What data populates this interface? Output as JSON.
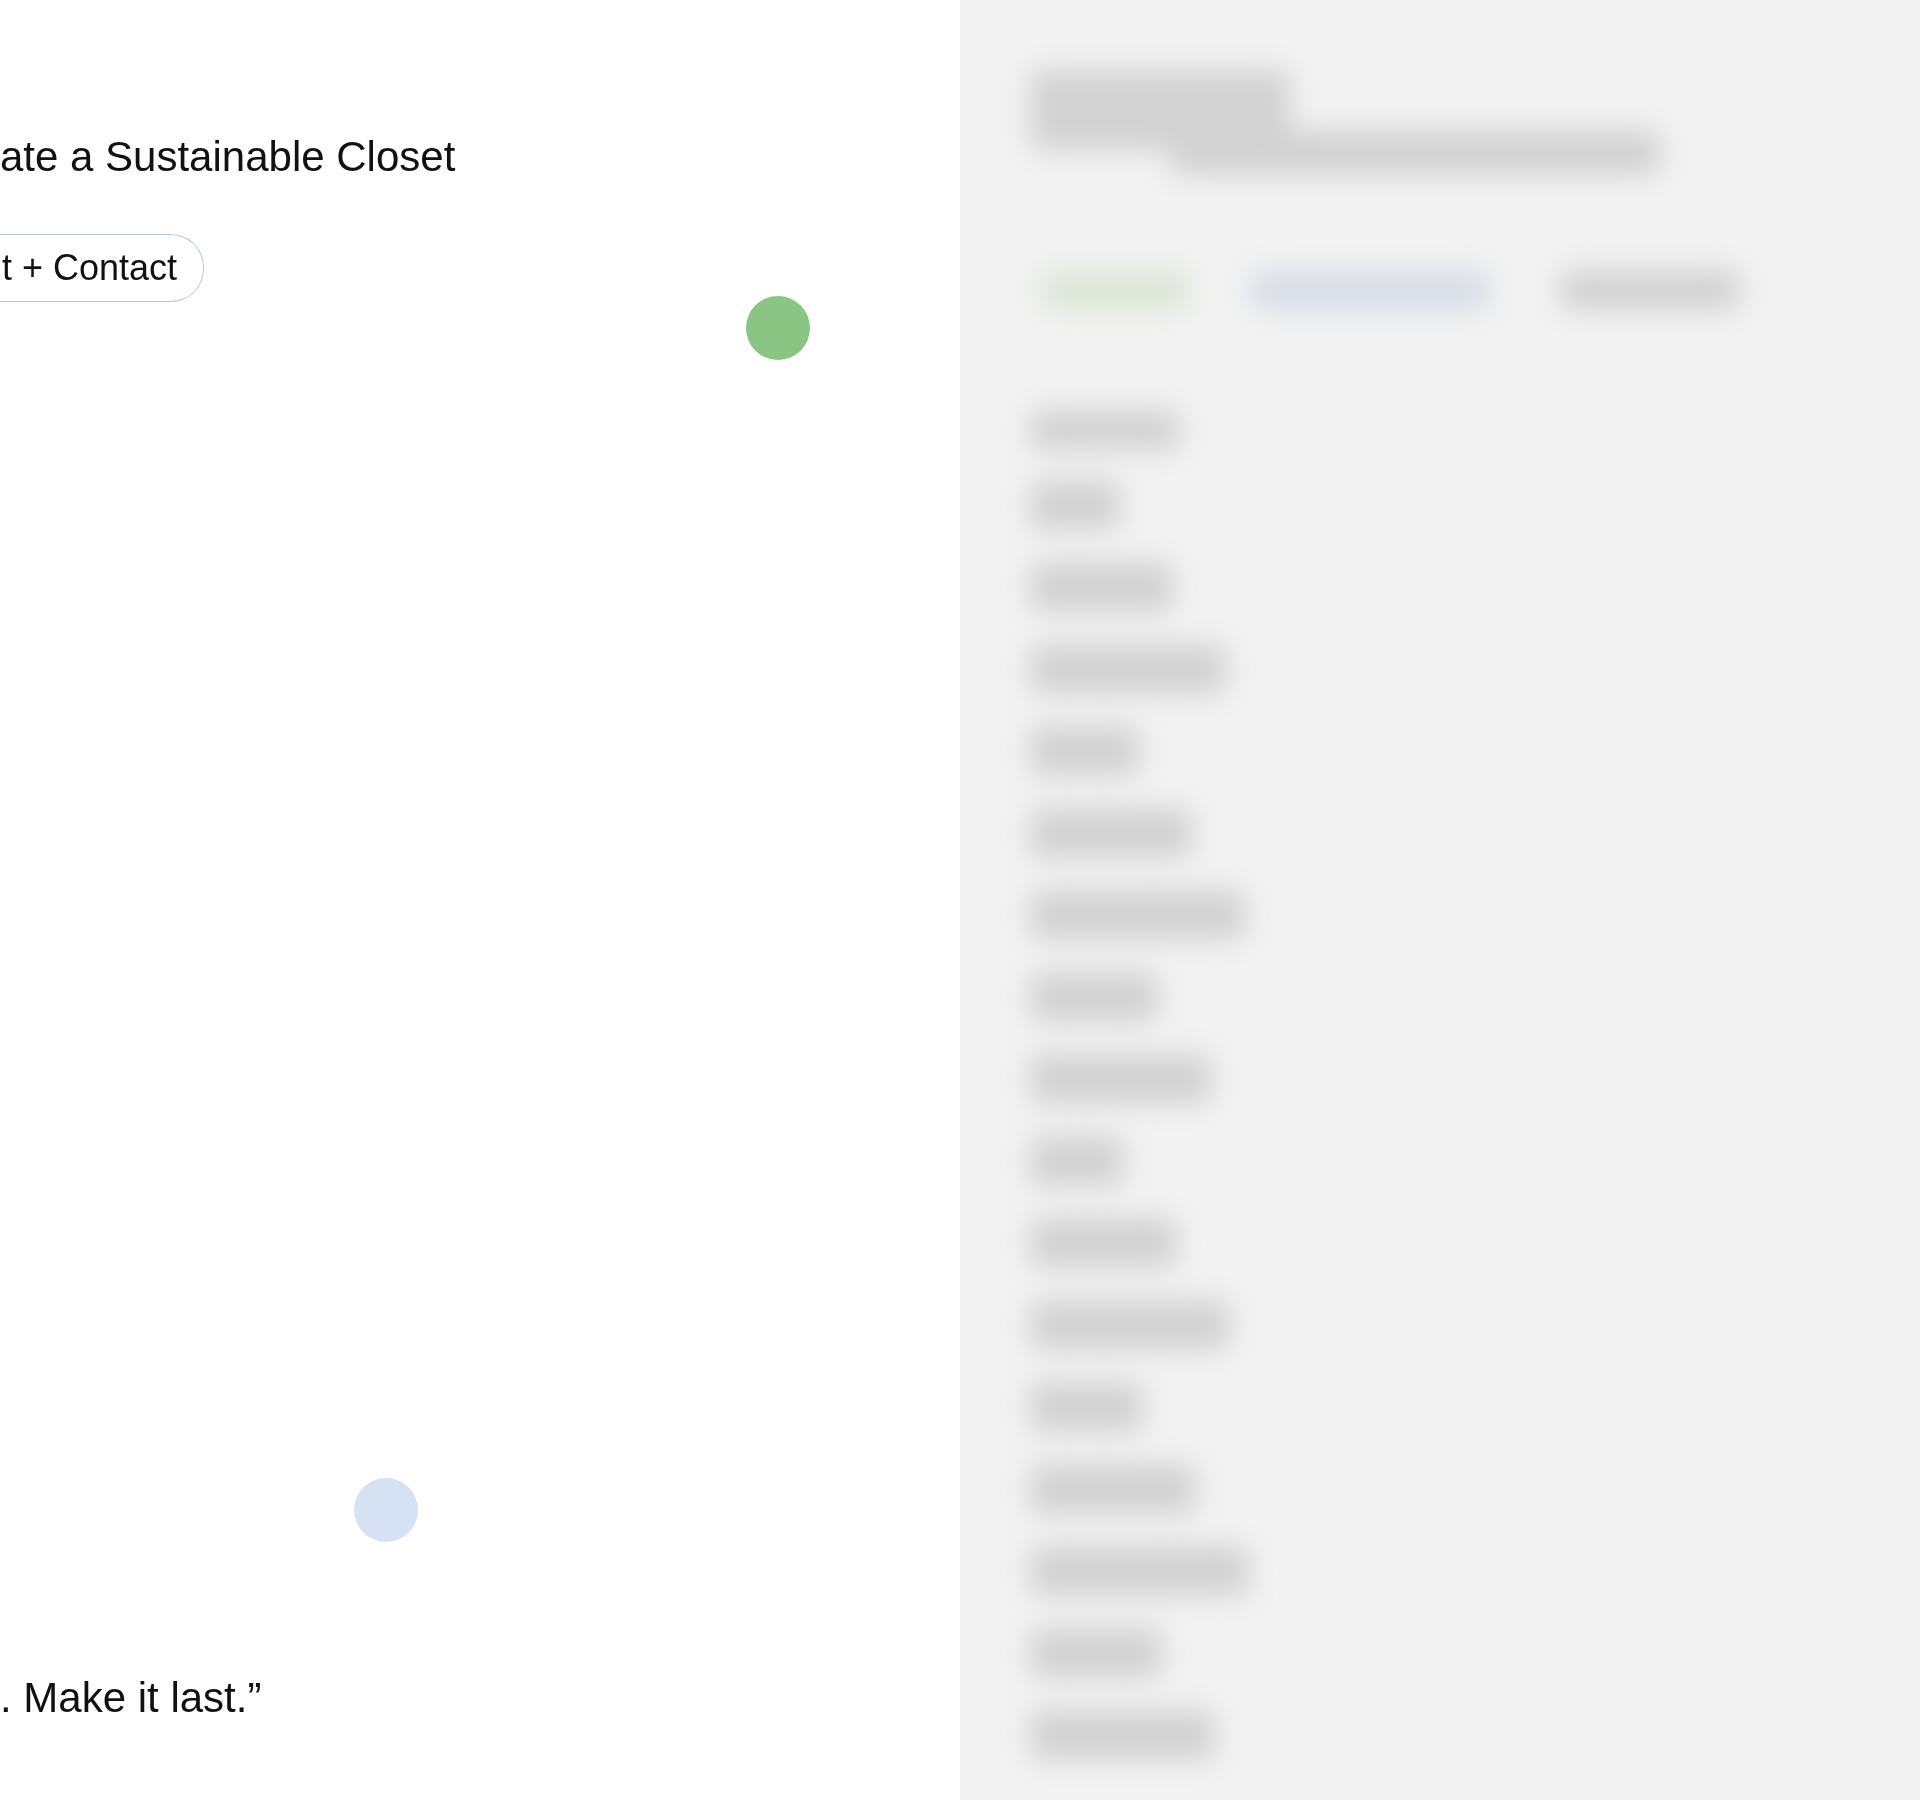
{
  "title": "ate a Sustainable Closet",
  "contact_button": {
    "label": "t + Contact"
  },
  "dots": [
    {
      "color": "#8bc583"
    },
    {
      "color": "#d6e2f4"
    }
  ],
  "quote": ". Make it last.”"
}
